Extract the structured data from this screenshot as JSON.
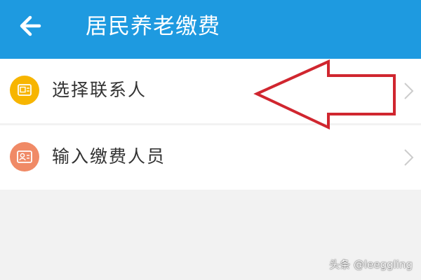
{
  "header": {
    "title": "居民养老缴费",
    "back_icon": "arrow-left-icon",
    "background_color": "#1e9ae0"
  },
  "list": {
    "items": [
      {
        "label": "选择联系人",
        "icon": "contact-card-icon",
        "icon_color": "#f7b500"
      },
      {
        "label": "输入缴费人员",
        "icon": "id-card-icon",
        "icon_color": "#f08a66"
      }
    ]
  },
  "annotation": {
    "icon": "red-outline-arrow-left",
    "color": "#d0262f"
  },
  "watermark": {
    "text": "头条 @leeggling"
  }
}
